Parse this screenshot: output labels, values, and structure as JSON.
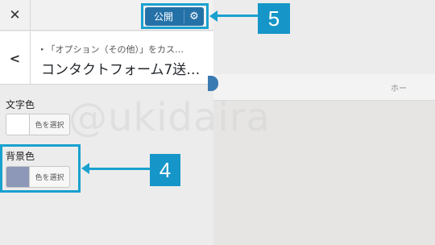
{
  "header": {
    "close_icon": "close-icon",
    "publish_label": "公開",
    "settings_icon": "gear-icon"
  },
  "section": {
    "back_icon": "chevron-left-icon",
    "breadcrumb": "「オプション（その他）」をカス…",
    "title": "コンタクトフォーム7送…"
  },
  "controls": [
    {
      "label": "文字色",
      "button_label": "色を選択",
      "color": "#ffffff"
    },
    {
      "label": "背景色",
      "button_label": "色を選択",
      "color": "#8d97b7"
    }
  ],
  "preview": {
    "nav_link": "ホー"
  },
  "watermark": "@ukidaira",
  "annotations": {
    "badge_5": "5",
    "badge_4": "4",
    "color": "#1696c8"
  }
}
